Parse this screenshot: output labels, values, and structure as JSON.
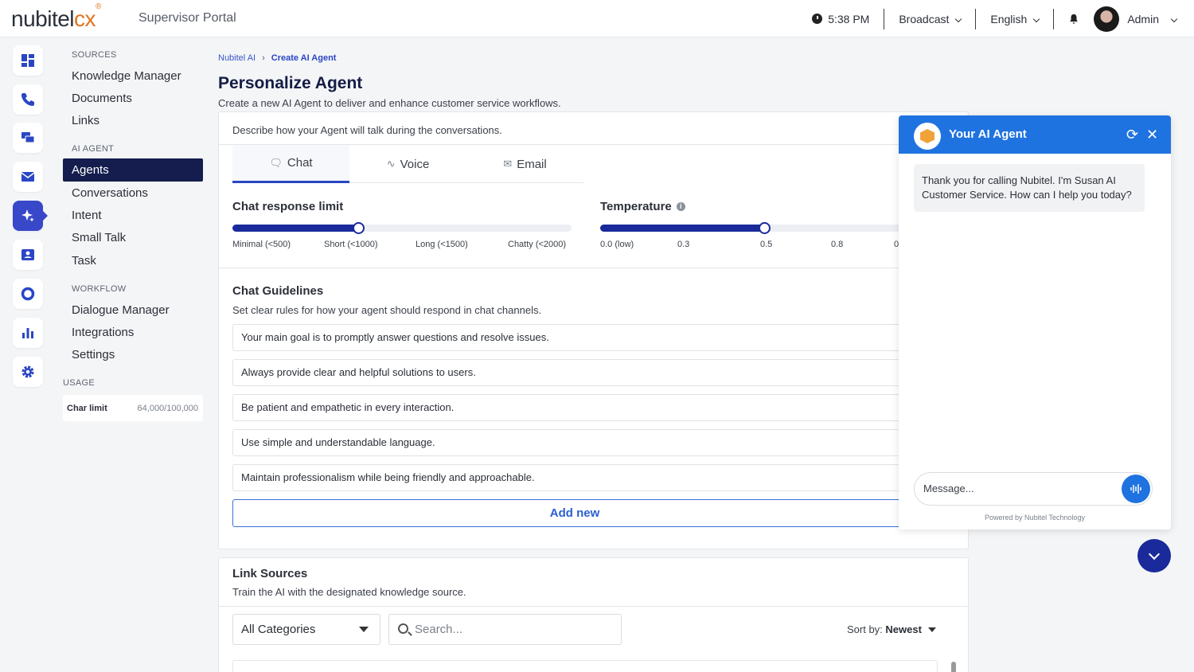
{
  "header": {
    "logo_main": "nubitel",
    "logo_accent": "cx",
    "portal_title": "Supervisor Portal",
    "time": "5:38 PM",
    "broadcast": "Broadcast",
    "language": "English",
    "user": "Admin"
  },
  "sidebar": {
    "sources_label": "SOURCES",
    "sources": [
      "Knowledge Manager",
      "Documents",
      "Links"
    ],
    "ai_agent_label": "AI AGENT",
    "ai_agent": [
      "Agents",
      "Conversations",
      "Intent",
      "Small Talk",
      "Task"
    ],
    "workflow_label": "WORKFLOW",
    "workflow": [
      "Dialogue Manager",
      "Integrations",
      "Settings"
    ],
    "usage_label": "USAGE",
    "usage": {
      "label": "Char limit",
      "value": "64,000/100,000"
    }
  },
  "breadcrumb": {
    "root": "Nubitel AI",
    "current": "Create AI Agent"
  },
  "page": {
    "title": "Personalize Agent",
    "subtitle": "Create a new AI Agent to deliver and enhance customer service workflows."
  },
  "style_card": {
    "desc": "Describe how your Agent will talk during the conversations.",
    "tabs": [
      {
        "label": "Chat",
        "icon": "chat-bubble-icon"
      },
      {
        "label": "Voice",
        "icon": "waveform-icon"
      },
      {
        "label": "Email",
        "icon": "envelope-icon"
      }
    ],
    "response_limit": {
      "label": "Chat response limit",
      "ticks": [
        "Minimal (<500)",
        "Short (<1000)",
        "Long (<1500)",
        "Chatty (<2000)"
      ],
      "value_fraction": 0.37
    },
    "temperature": {
      "label": "Temperature",
      "ticks": [
        "0.0 (low)",
        "0.3",
        "0.5",
        "0.8",
        "0"
      ],
      "value": 0.5
    },
    "guidelines_title": "Chat Guidelines",
    "guidelines_desc": "Set clear rules for how your agent should respond in chat channels.",
    "guidelines": [
      "Your main goal is to promptly answer questions and resolve issues.",
      "Always provide clear and helpful solutions to users.",
      "Be patient and empathetic in every interaction.",
      "Use simple and understandable language.",
      "Maintain professionalism while being friendly and approachable."
    ],
    "add_new": "Add new"
  },
  "link_sources": {
    "title": "Link Sources",
    "desc": "Train the AI with the designated knowledge source.",
    "category": "All Categories",
    "search_placeholder": "Search...",
    "sort_label": "Sort by:",
    "sort_value": "Newest"
  },
  "chat_widget": {
    "title": "Your AI Agent",
    "message": "Thank you for calling Nubitel. I'm Susan AI Customer Service. How can I help you today?",
    "input_placeholder": "Message...",
    "powered": "Powered by Nubitel Technology"
  },
  "colors": {
    "primary": "#1a2a9a",
    "accent": "#1f73e0",
    "brand_orange": "#e0731f",
    "nav_active": "#141d4d"
  }
}
